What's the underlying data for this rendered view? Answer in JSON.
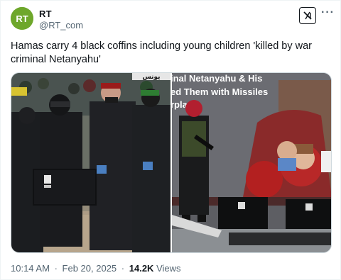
{
  "tweet": {
    "author_name": "RT",
    "author_handle": "@RT_com",
    "avatar_text": "RT",
    "text": "Hamas carry 4 black coffins including young children 'killed by war criminal Netanyahu'",
    "time": "10:14 AM",
    "date": "Feb 20, 2025",
    "views_count": "14.2K",
    "views_label": "Views",
    "separator": "·"
  },
  "media": {
    "right_poster_lines": [
      "inal Netanyahu & His",
      "ed Them with Missiles",
      "rplan"
    ],
    "left_banner_text": "يونس"
  },
  "icons": {
    "avatar": "rt-logo-icon",
    "x_button": "grok-icon",
    "more": "more-options-icon"
  },
  "colors": {
    "brand_green": "#6ea72b",
    "text_primary": "#0f1419",
    "text_secondary": "#536471"
  }
}
